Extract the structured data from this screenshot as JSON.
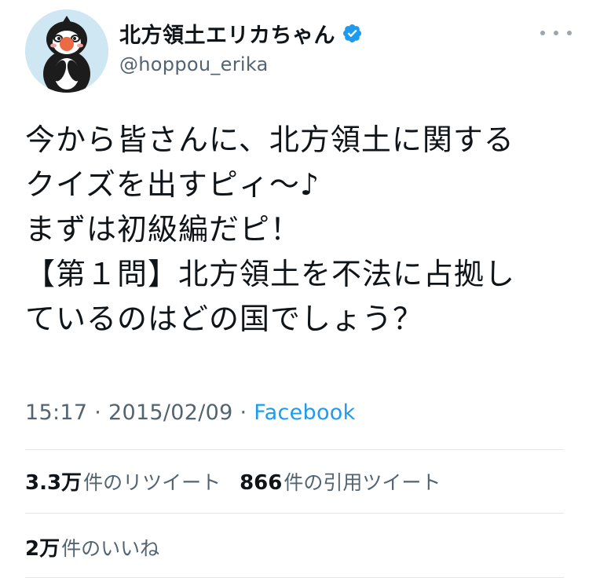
{
  "author": {
    "display_name": "北方領土エリカちゃん",
    "handle": "@hoppou_erika",
    "verified": true
  },
  "tweet": {
    "text": "今から皆さんに、北方領土に関する\nクイズを出すピィ〜♪\nまずは初級編だピ！\n【第１問】北方領土を不法に占拠し\nているのはどの国でしょう？",
    "time": "15:17",
    "separator": "·",
    "date": "2015/02/09",
    "source": "Facebook"
  },
  "stats": {
    "retweets": {
      "count": "3.3万",
      "label": "件のリツイート"
    },
    "quotes": {
      "count": "866",
      "label": "件の引用ツイート"
    },
    "likes": {
      "count": "2万",
      "label": "件のいいね"
    }
  },
  "colors": {
    "accent": "#1d9bf0",
    "text": "#0f1419",
    "secondary": "#536471",
    "divider": "#e3e7ea"
  }
}
